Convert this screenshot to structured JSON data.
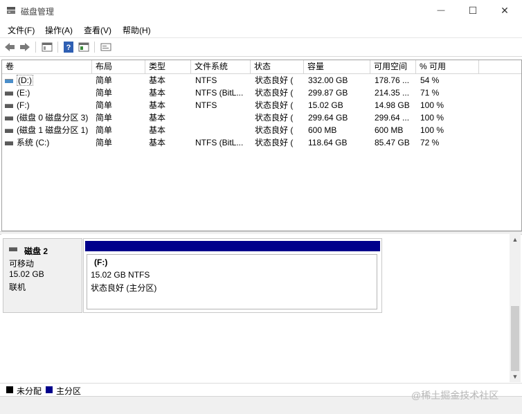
{
  "window": {
    "title": "磁盘管理",
    "controls": {
      "minimize": "—",
      "maximize": "☐",
      "close": "✕"
    }
  },
  "menu": [
    "文件(F)",
    "操作(A)",
    "查看(V)",
    "帮助(H)"
  ],
  "toolbar_icons": [
    "back-arrow-icon",
    "forward-arrow-icon",
    "properties-icon",
    "help-icon",
    "console-icon",
    "settings-icon"
  ],
  "columns": [
    "卷",
    "布局",
    "类型",
    "文件系统",
    "状态",
    "容量",
    "可用空间",
    "% 可用"
  ],
  "rows": [
    {
      "volume": "(D:)",
      "layout": "简单",
      "type": "基本",
      "fs": "NTFS",
      "status": "状态良好 (",
      "capacity": "332.00 GB",
      "free": "178.76 ...",
      "pct": "54 %"
    },
    {
      "volume": "(E:)",
      "layout": "简单",
      "type": "基本",
      "fs": "NTFS (BitL...",
      "status": "状态良好 (",
      "capacity": "299.87 GB",
      "free": "214.35 ...",
      "pct": "71 %"
    },
    {
      "volume": "(F:)",
      "layout": "简单",
      "type": "基本",
      "fs": "NTFS",
      "status": "状态良好 (",
      "capacity": "15.02 GB",
      "free": "14.98 GB",
      "pct": "100 %"
    },
    {
      "volume": "(磁盘 0 磁盘分区 3)",
      "layout": "简单",
      "type": "基本",
      "fs": "",
      "status": "状态良好 (",
      "capacity": "299.64 GB",
      "free": "299.64 ...",
      "pct": "100 %"
    },
    {
      "volume": "(磁盘 1 磁盘分区 1)",
      "layout": "简单",
      "type": "基本",
      "fs": "",
      "status": "状态良好 (",
      "capacity": "600 MB",
      "free": "600 MB",
      "pct": "100 %"
    },
    {
      "volume": "系统 (C:)",
      "layout": "简单",
      "type": "基本",
      "fs": "NTFS (BitL...",
      "status": "状态良好 (",
      "capacity": "118.64 GB",
      "free": "85.47 GB",
      "pct": "72 %"
    }
  ],
  "disk": {
    "name": "磁盘 2",
    "kind": "可移动",
    "size": "15.02 GB",
    "state": "联机",
    "partition": {
      "label": "(F:)",
      "size_fs": "15.02 GB NTFS",
      "status": "状态良好 (主分区)",
      "header_color": "#00008b"
    }
  },
  "legend": [
    {
      "label": "未分配",
      "color": "#000000"
    },
    {
      "label": "主分区",
      "color": "#00008b"
    }
  ],
  "watermark": "@稀土掘金技术社区"
}
